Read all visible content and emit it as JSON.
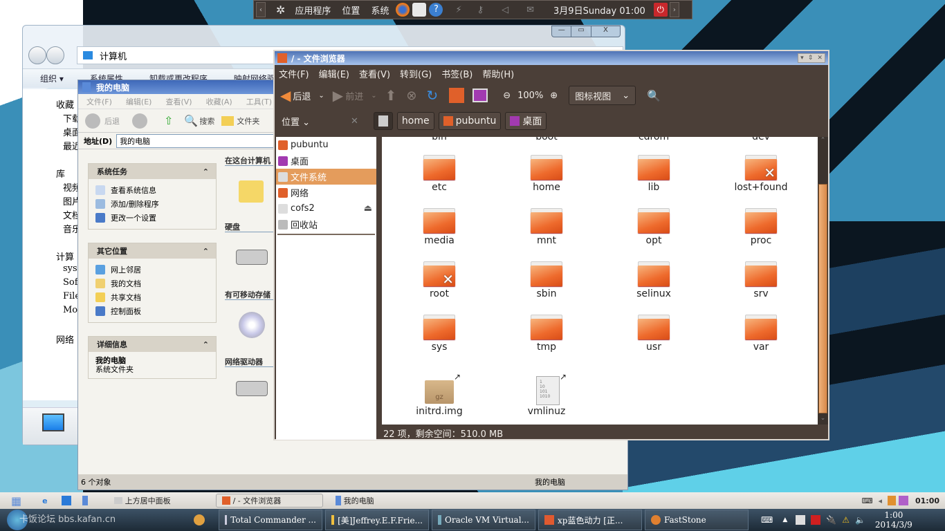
{
  "gnome_panel": {
    "menus": [
      "应用程序",
      "位置",
      "系统"
    ],
    "clock": "3月9日Sunday 01:00",
    "colors": {
      "power": "#c8282c",
      "panel_bg": "#3b3430"
    }
  },
  "win7_explorer": {
    "breadcrumb": "计算机",
    "commands": [
      "组织 ▾",
      "系统属性",
      "卸载或更改程序",
      "映射网络驱"
    ],
    "nav_items": [
      "收藏",
      "下载",
      "桌面",
      "最近",
      "库",
      "视频",
      "图片",
      "文档",
      "音乐",
      "计算",
      "sys",
      "Soft",
      "File",
      "Mov",
      "网络"
    ],
    "window_controls": [
      "—",
      "▭",
      "X"
    ]
  },
  "xp_window": {
    "title": "我的电脑",
    "menus": [
      "文件(F)",
      "编辑(E)",
      "查看(V)",
      "收藏(A)",
      "工具(T)"
    ],
    "toolbar": {
      "back": "后退",
      "search": "搜索",
      "folders": "文件夹"
    },
    "address_label": "地址(D)",
    "address_value": "我的电脑",
    "panels": [
      {
        "title": "系统任务",
        "items": [
          "查看系统信息",
          "添加/删除程序",
          "更改一个设置"
        ]
      },
      {
        "title": "其它位置",
        "items": [
          "网上邻居",
          "我的文档",
          "共享文档",
          "控制面板"
        ]
      },
      {
        "title": "详细信息",
        "items": [
          "我的电脑",
          "系统文件夹"
        ]
      }
    ],
    "sections": [
      "在这台计算机",
      "硬盘",
      "有可移动存储",
      "网络驱动器"
    ],
    "status_left": "6 个对象",
    "status_right": "我的电脑"
  },
  "nautilus": {
    "title": "/ - 文件浏览器",
    "menus": [
      "文件(F)",
      "编辑(E)",
      "查看(V)",
      "转到(G)",
      "书签(B)",
      "帮助(H)"
    ],
    "toolbar": {
      "back": "后退",
      "forward": "前进",
      "zoom": "100%",
      "view_mode": "图标视图"
    },
    "places_label": "位置",
    "breadcrumbs": [
      "home",
      "pubuntu",
      "桌面"
    ],
    "sidebar": [
      "pubuntu",
      "桌面",
      "文件系统",
      "网络",
      "cofs2",
      "回收站"
    ],
    "sidebar_selected": "文件系统",
    "partial_row": [
      "bin",
      "boot",
      "cdrom",
      "dev"
    ],
    "items": [
      {
        "name": "etc",
        "type": "folder"
      },
      {
        "name": "home",
        "type": "folder"
      },
      {
        "name": "lib",
        "type": "folder"
      },
      {
        "name": "lost+found",
        "type": "folder-locked"
      },
      {
        "name": "media",
        "type": "folder"
      },
      {
        "name": "mnt",
        "type": "folder"
      },
      {
        "name": "opt",
        "type": "folder"
      },
      {
        "name": "proc",
        "type": "folder"
      },
      {
        "name": "root",
        "type": "folder-locked"
      },
      {
        "name": "sbin",
        "type": "folder"
      },
      {
        "name": "selinux",
        "type": "folder"
      },
      {
        "name": "srv",
        "type": "folder"
      },
      {
        "name": "sys",
        "type": "folder"
      },
      {
        "name": "tmp",
        "type": "folder"
      },
      {
        "name": "usr",
        "type": "folder"
      },
      {
        "name": "var",
        "type": "folder"
      },
      {
        "name": "initrd.img",
        "type": "archive-link"
      },
      {
        "name": "vmlinuz",
        "type": "binary-link"
      }
    ],
    "status": "22 项，剩余空间：510.0 MB",
    "colors": {
      "folder": "#ee6a2c",
      "selection": "#e49c5c",
      "chrome": "#4b3f38"
    }
  },
  "xp_taskbar": {
    "buttons": [
      "上方居中面板",
      "/ - 文件浏览器",
      "我的电脑"
    ],
    "clock": "01:00"
  },
  "win7_taskbar": {
    "watermark": "卡饭论坛 bbs.kafan.cn",
    "buttons": [
      "Total Commander ...",
      "[美]Jeffrey.E.F.Frie...",
      "Oracle VM Virtual...",
      "xp蓝色动力 [正...",
      "FastStone"
    ],
    "time": "1:00",
    "date": "2014/3/9"
  }
}
